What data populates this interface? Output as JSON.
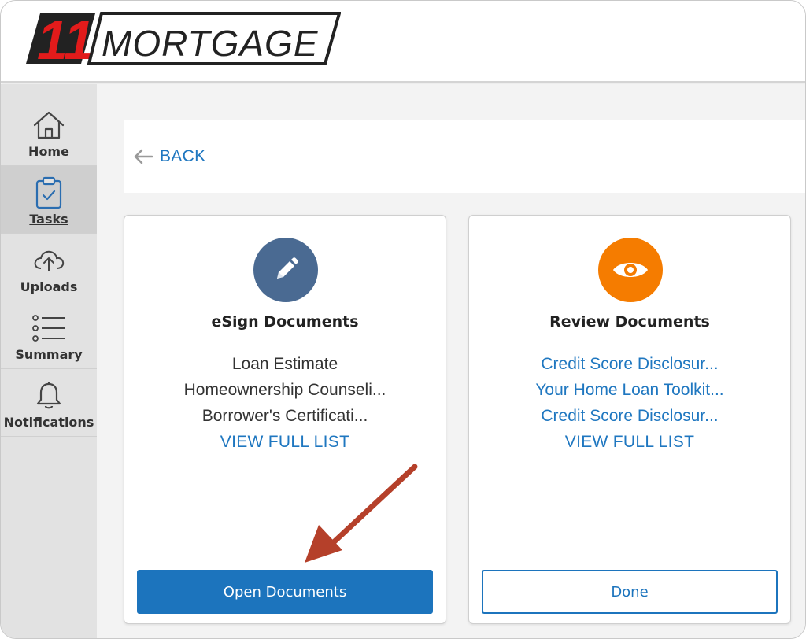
{
  "brand": {
    "logo_number": "11",
    "logo_word": "MORTGAGE",
    "accent_color": "#e21b1b",
    "dark_color": "#222222"
  },
  "sidebar": {
    "items": [
      {
        "label": "Home",
        "icon": "home-icon",
        "active": false
      },
      {
        "label": "Tasks",
        "icon": "clipboard-check-icon",
        "active": true
      },
      {
        "label": "Uploads",
        "icon": "cloud-upload-icon",
        "active": false
      },
      {
        "label": "Summary",
        "icon": "list-icon",
        "active": false
      },
      {
        "label": "Notifications",
        "icon": "bell-icon",
        "active": false
      }
    ]
  },
  "main": {
    "back_label": "BACK",
    "cards": [
      {
        "title": "eSign Documents",
        "icon": "pencil-icon",
        "icon_color": "#4a6a92",
        "documents": [
          "Loan Estimate",
          "Homeownership Counseli...",
          "Borrower's Certificati..."
        ],
        "view_full_list": "VIEW FULL LIST",
        "button_label": "Open Documents"
      },
      {
        "title": "Review Documents",
        "icon": "eye-icon",
        "icon_color": "#f57c00",
        "documents": [
          "Credit Score Disclosur...",
          "Your Home Loan Toolkit...",
          "Credit Score Disclosur..."
        ],
        "view_full_list": "VIEW FULL LIST",
        "button_label": "Done"
      }
    ]
  },
  "colors": {
    "link_blue": "#1f77c0",
    "primary_button": "#1c74bd",
    "annotation_arrow": "#b5402a"
  }
}
